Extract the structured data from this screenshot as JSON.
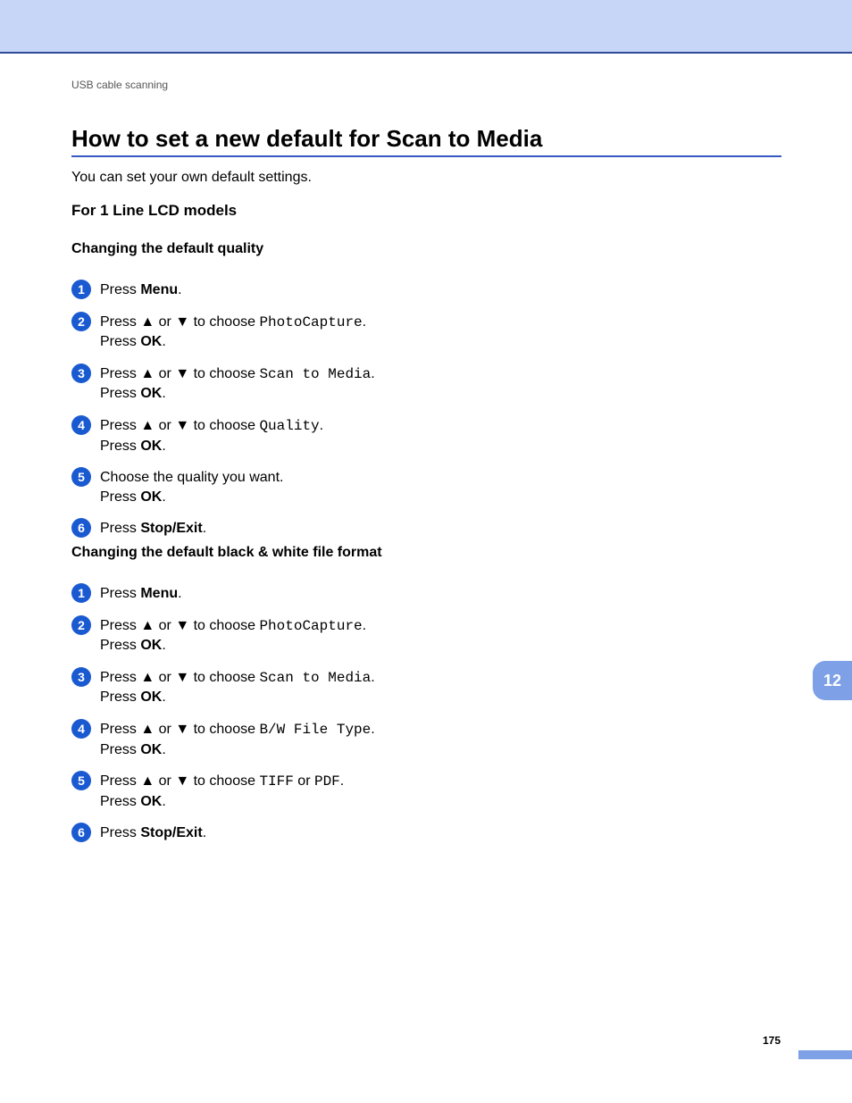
{
  "header": {
    "breadcrumb": "USB cable scanning"
  },
  "title": "How to set a new default for Scan to Media",
  "intro": "You can set your own default settings.",
  "sub1": "For 1 Line LCD models",
  "sectionA": {
    "heading": "Changing the default quality",
    "steps": [
      {
        "n": "1",
        "t1a": "Press ",
        "b1": "Menu",
        "t1b": "."
      },
      {
        "n": "2",
        "t1a": "Press ",
        "arr1": "▲",
        "t1b": " or ",
        "arr2": "▼",
        "t1c": " to choose ",
        "mono": "PhotoCapture",
        "t1d": ".",
        "l2a": "Press ",
        "l2b": "OK",
        "l2c": "."
      },
      {
        "n": "3",
        "t1a": "Press ",
        "arr1": "▲",
        "t1b": " or ",
        "arr2": "▼",
        "t1c": " to choose ",
        "mono": "Scan to Media",
        "t1d": ".",
        "l2a": "Press ",
        "l2b": "OK",
        "l2c": "."
      },
      {
        "n": "4",
        "t1a": "Press ",
        "arr1": "▲",
        "t1b": " or ",
        "arr2": "▼",
        "t1c": " to choose ",
        "mono": "Quality",
        "t1d": ".",
        "l2a": "Press ",
        "l2b": "OK",
        "l2c": "."
      },
      {
        "n": "5",
        "t1a": "Choose the quality you want.",
        "l2a": "Press ",
        "l2b": "OK",
        "l2c": "."
      },
      {
        "n": "6",
        "t1a": "Press ",
        "b1": "Stop/Exit",
        "t1b": "."
      }
    ]
  },
  "sectionB": {
    "heading": "Changing the default black & white file format",
    "steps": [
      {
        "n": "1",
        "t1a": "Press ",
        "b1": "Menu",
        "t1b": "."
      },
      {
        "n": "2",
        "t1a": "Press ",
        "arr1": "▲",
        "t1b": " or ",
        "arr2": "▼",
        "t1c": " to choose ",
        "mono": "PhotoCapture",
        "t1d": ".",
        "l2a": "Press ",
        "l2b": "OK",
        "l2c": "."
      },
      {
        "n": "3",
        "t1a": "Press ",
        "arr1": "▲",
        "t1b": " or ",
        "arr2": "▼",
        "t1c": " to choose ",
        "mono": "Scan to Media",
        "t1d": ".",
        "l2a": "Press ",
        "l2b": "OK",
        "l2c": "."
      },
      {
        "n": "4",
        "t1a": "Press ",
        "arr1": "▲",
        "t1b": " or ",
        "arr2": "▼",
        "t1c": " to choose ",
        "mono": "B/W File Type",
        "t1d": ".",
        "l2a": "Press ",
        "l2b": "OK",
        "l2c": "."
      },
      {
        "n": "5",
        "t1a": "Press ",
        "arr1": "▲",
        "t1b": " or ",
        "arr2": "▼",
        "t1c": " to choose ",
        "mono": "TIFF",
        "t1d": " or ",
        "mono2": "PDF",
        "t1e": ".",
        "l2a": "Press ",
        "l2b": "OK",
        "l2c": "."
      },
      {
        "n": "6",
        "t1a": "Press ",
        "b1": "Stop/Exit",
        "t1b": "."
      }
    ]
  },
  "sectionTab": "12",
  "pageNumber": "175"
}
